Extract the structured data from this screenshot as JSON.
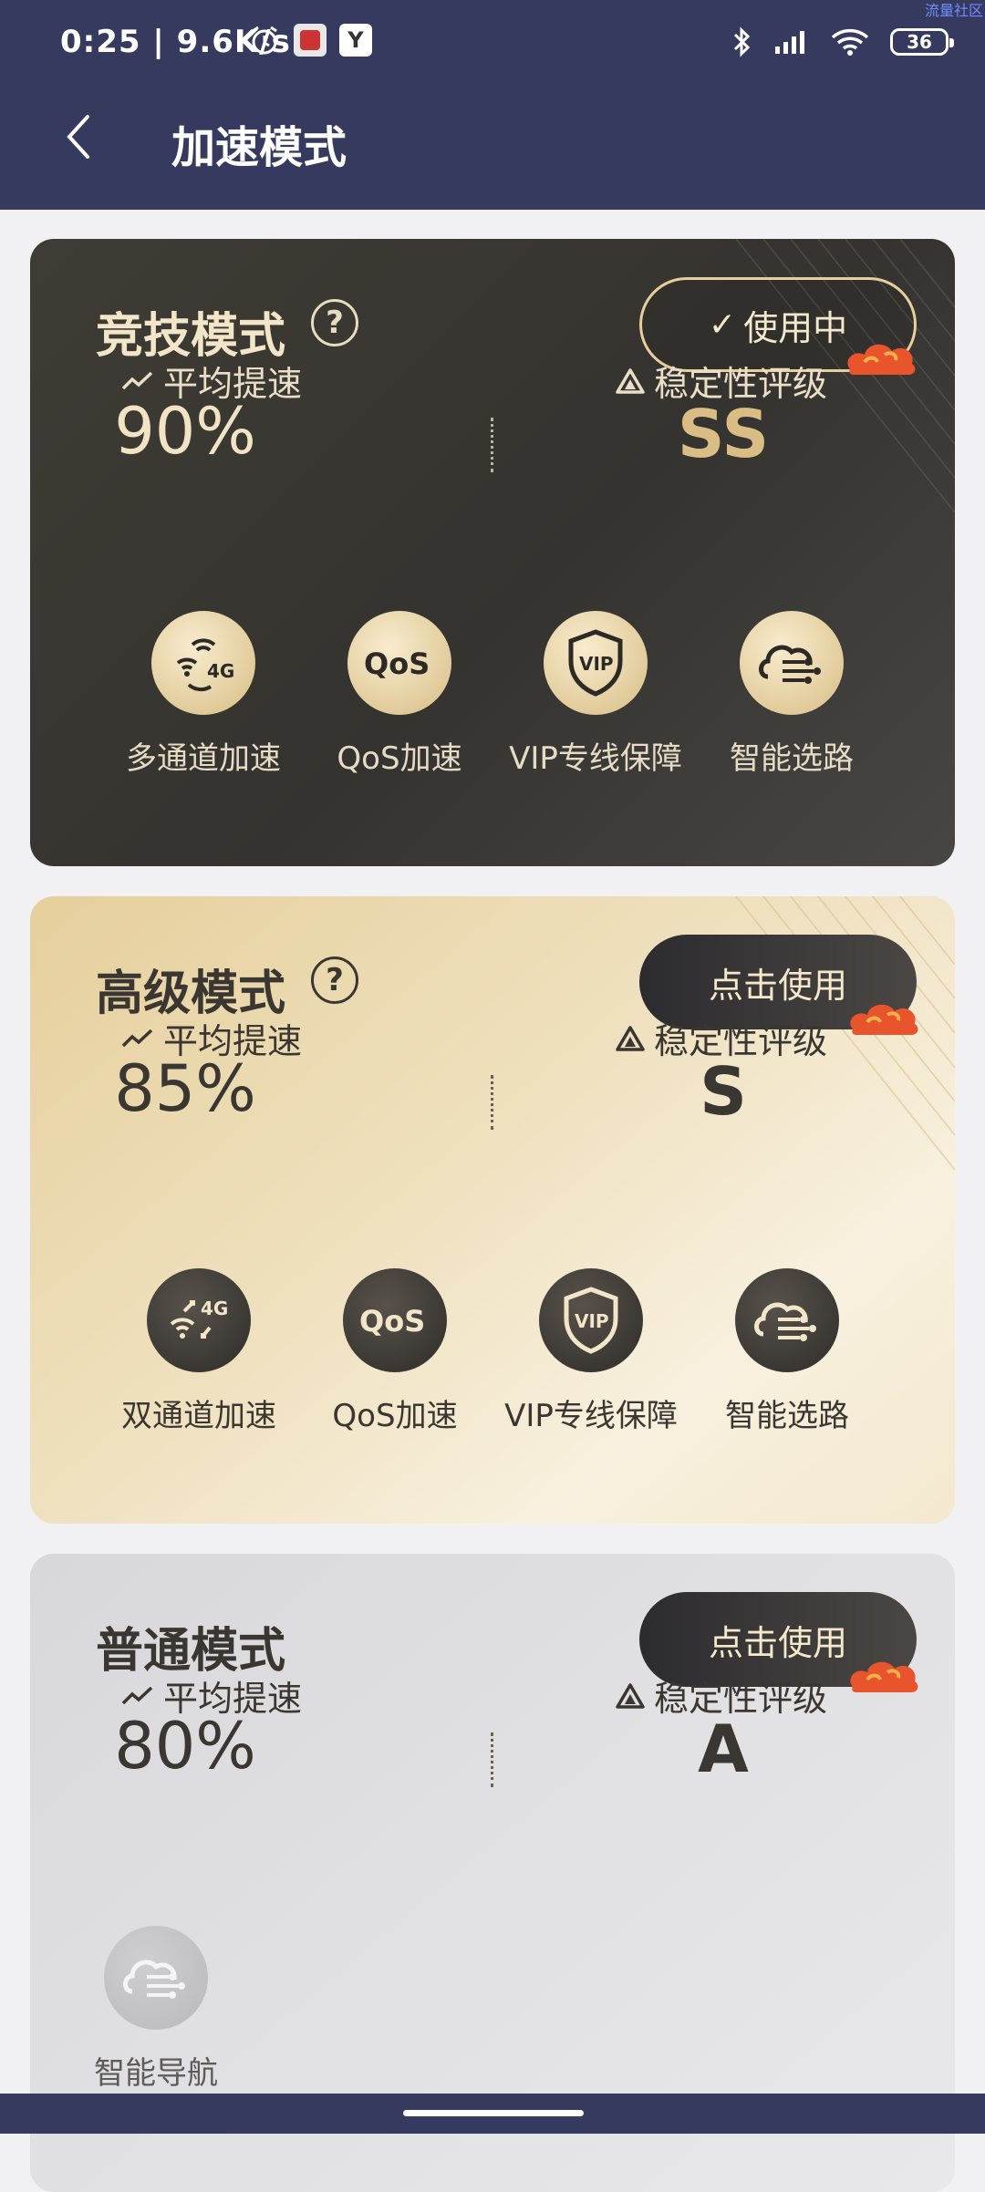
{
  "status_bar": {
    "time": "0:25",
    "speed": "9.6K/s",
    "battery": "36",
    "watermark": "流量社区"
  },
  "header": {
    "title": "加速模式"
  },
  "cards": [
    {
      "title": "竞技模式",
      "action_label": "使用中",
      "avg_label": "平均提速",
      "avg_value": "90%",
      "stability_label": "稳定性评级",
      "stability_value": "SS",
      "features": [
        {
          "label": "多通道加速",
          "icon": "multi-channel-4g-icon"
        },
        {
          "label": "QoS加速",
          "icon": "qos-icon"
        },
        {
          "label": "VIP专线保障",
          "icon": "vip-shield-icon"
        },
        {
          "label": "智能选路",
          "icon": "smart-route-cloud-icon"
        }
      ]
    },
    {
      "title": "高级模式",
      "action_label": "点击使用",
      "avg_label": "平均提速",
      "avg_value": "85%",
      "stability_label": "稳定性评级",
      "stability_value": "S",
      "features": [
        {
          "label": "双通道加速",
          "icon": "dual-channel-4g-icon"
        },
        {
          "label": "QoS加速",
          "icon": "qos-icon"
        },
        {
          "label": "VIP专线保障",
          "icon": "vip-shield-icon"
        },
        {
          "label": "智能选路",
          "icon": "smart-route-cloud-icon"
        }
      ]
    },
    {
      "title": "普通模式",
      "action_label": "点击使用",
      "avg_label": "平均提速",
      "avg_value": "80%",
      "stability_label": "稳定性评级",
      "stability_value": "A",
      "features": [
        {
          "label": "智能导航",
          "icon": "smart-navigation-cloud-icon"
        }
      ]
    }
  ]
}
